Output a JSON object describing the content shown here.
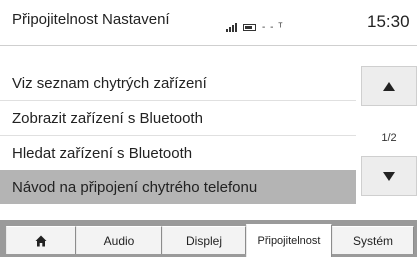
{
  "header": {
    "title": "Připojitelnost Nastavení",
    "clock": "15:30",
    "network": "- - ᵀ"
  },
  "menu": {
    "items": [
      {
        "label": "Viz seznam chytrých zařízení",
        "selected": false
      },
      {
        "label": "Zobrazit zařízení s Bluetooth",
        "selected": false
      },
      {
        "label": "Hledat zařízení s Bluetooth",
        "selected": false
      },
      {
        "label": "Návod na připojení chytrého telefonu",
        "selected": true
      }
    ]
  },
  "scroll": {
    "page_indicator": "1/2",
    "up_icon": "triangle-up-icon",
    "down_icon": "triangle-down-icon"
  },
  "tabs": {
    "home_icon": "home-icon",
    "items": [
      {
        "label": "Audio",
        "active": false
      },
      {
        "label": "Displej",
        "active": false
      },
      {
        "label": "Připojitelnost",
        "active": true
      },
      {
        "label": "Systém",
        "active": false
      }
    ]
  },
  "colors": {
    "selection": "#b4b4b4",
    "tabbar": "#9a9a9a",
    "tab": "#f3f3f3"
  }
}
